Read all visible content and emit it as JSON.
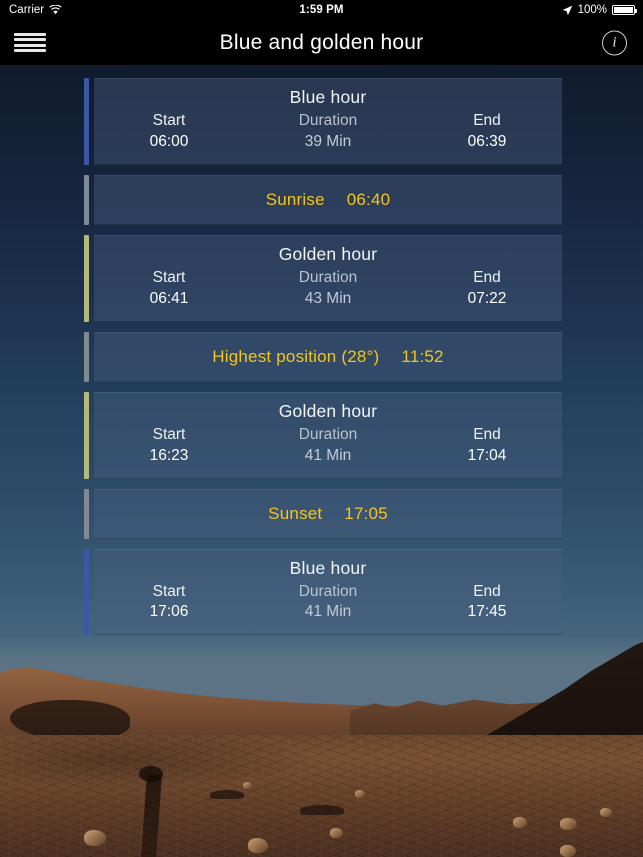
{
  "status_bar": {
    "carrier": "Carrier",
    "wifi_icon": "wifi-icon",
    "time": "1:59 PM",
    "location_icon": "location-arrow-icon",
    "battery_percent": "100%",
    "battery_icon": "battery-full-icon"
  },
  "nav_bar": {
    "menu_icon": "hamburger-menu-icon",
    "title": "Blue and golden hour",
    "info_icon": "info-circle-icon"
  },
  "colors": {
    "blue_hour_accent": "#3d56a8",
    "golden_hour_accent": "#b6b87a",
    "neutral_accent": "#808a95",
    "moment_text": "#f5c518",
    "card_bg": "rgba(73,96,128,.42)",
    "nav_bg": "#000000"
  },
  "column_headers": {
    "start": "Start",
    "duration": "Duration",
    "end": "End"
  },
  "events": [
    {
      "kind": "interval",
      "accent": "blue",
      "title": "Blue hour",
      "start": "06:00",
      "duration": "39 Min",
      "end": "06:39"
    },
    {
      "kind": "moment",
      "accent": "neutral",
      "label": "Sunrise",
      "time": "06:40"
    },
    {
      "kind": "interval",
      "accent": "golden",
      "title": "Golden hour",
      "start": "06:41",
      "duration": "43 Min",
      "end": "07:22"
    },
    {
      "kind": "moment",
      "accent": "neutral",
      "label": "Highest position (28°)",
      "time": "11:52"
    },
    {
      "kind": "interval",
      "accent": "golden",
      "title": "Golden hour",
      "start": "16:23",
      "duration": "41 Min",
      "end": "17:04"
    },
    {
      "kind": "moment",
      "accent": "neutral",
      "label": "Sunset",
      "time": "17:05"
    },
    {
      "kind": "interval",
      "accent": "blue",
      "title": "Blue hour",
      "start": "17:06",
      "duration": "41 Min",
      "end": "17:45"
    }
  ]
}
